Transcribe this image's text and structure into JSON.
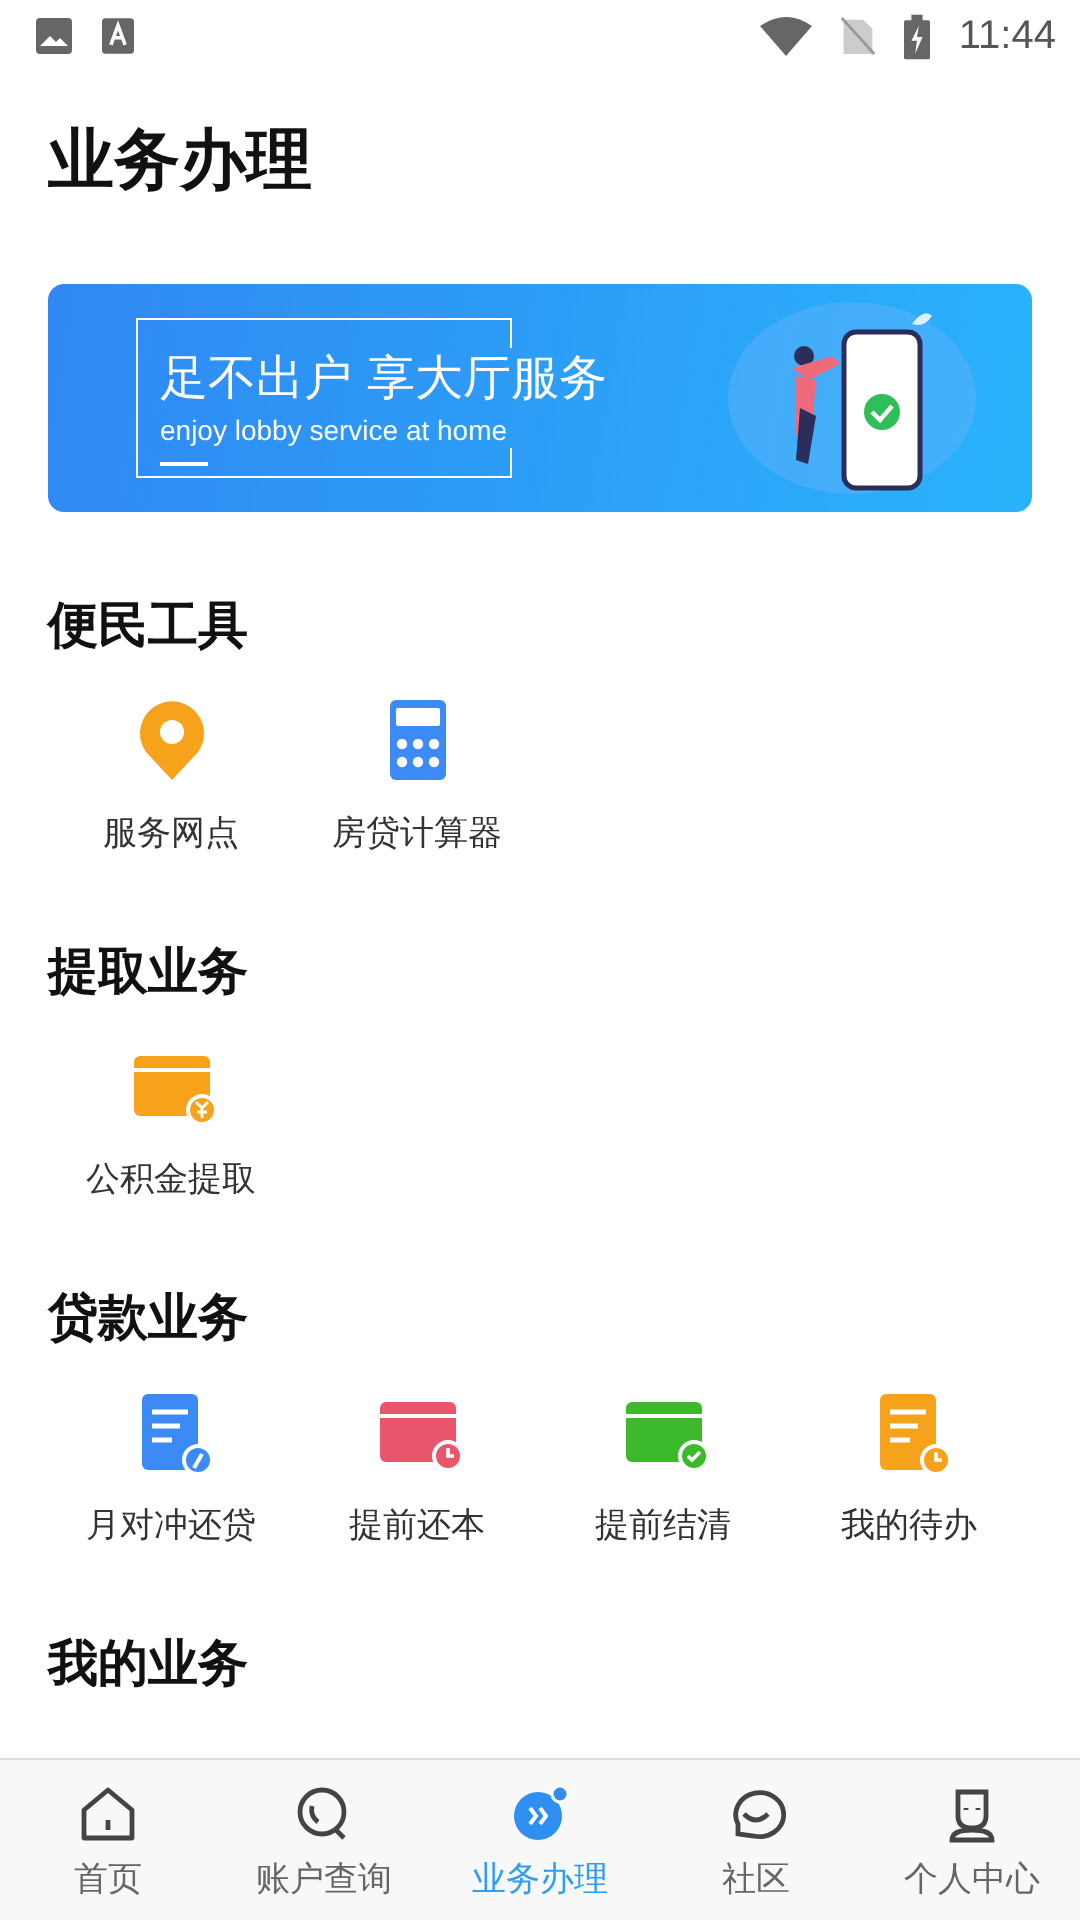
{
  "status_bar": {
    "time": "11:44"
  },
  "page_title": "业务办理",
  "banner": {
    "headline": "足不出户 享大厅服务",
    "subtitle": "enjoy lobby service at home"
  },
  "sections": [
    {
      "title": "便民工具",
      "items": [
        {
          "label": "服务网点",
          "kind": "pin",
          "color": "#f7a21b"
        },
        {
          "label": "房贷计算器",
          "kind": "calculator",
          "color": "#3b8af5"
        }
      ]
    },
    {
      "title": "提取业务",
      "items": [
        {
          "label": "公积金提取",
          "kind": "card-yen",
          "color": "#f7a21b"
        }
      ]
    },
    {
      "title": "贷款业务",
      "items": [
        {
          "label": "月对冲还贷",
          "kind": "doc-pen",
          "color": "#3b8af5"
        },
        {
          "label": "提前还本",
          "kind": "card-clock",
          "color": "#e9556b"
        },
        {
          "label": "提前结清",
          "kind": "card-check",
          "color": "#3cba2c"
        },
        {
          "label": "我的待办",
          "kind": "doc-clock",
          "color": "#f7a21b"
        }
      ]
    },
    {
      "title": "我的业务"
    }
  ],
  "tab_bar": [
    {
      "label": "首页",
      "kind": "home",
      "selected": false
    },
    {
      "label": "账户查询",
      "kind": "search",
      "selected": false
    },
    {
      "label": "业务办理",
      "kind": "forward",
      "selected": true
    },
    {
      "label": "社区",
      "kind": "chat",
      "selected": false
    },
    {
      "label": "个人中心",
      "kind": "person",
      "selected": false
    }
  ]
}
